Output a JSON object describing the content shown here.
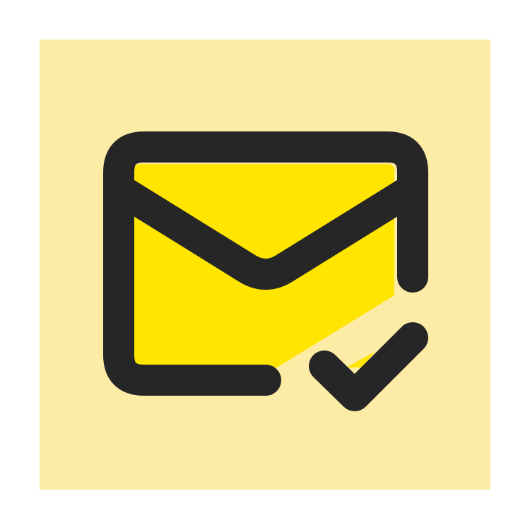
{
  "icon": {
    "name": "mail-check-icon",
    "colors": {
      "page_background": "#ffffff",
      "tile_background": "#fdeca6",
      "envelope_fill": "#ffe500",
      "stroke": "#262626"
    }
  }
}
